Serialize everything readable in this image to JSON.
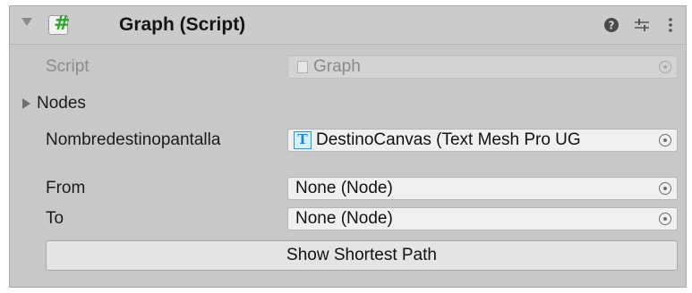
{
  "component": {
    "title": "Graph (Script)",
    "icons": {
      "script": "csharp-script-icon",
      "help": "help-icon",
      "presets": "presets-sliders-icon",
      "menu": "kebab-menu-icon"
    }
  },
  "fields": {
    "script": {
      "label": "Script",
      "value": "Graph"
    },
    "nodes": {
      "label": "Nodes"
    },
    "nombre": {
      "label": "Nombredestinopantalla",
      "value": "DestinoCanvas (Text Mesh Pro UG"
    },
    "from": {
      "label": "From",
      "value": "None (Node)"
    },
    "to": {
      "label": "To",
      "value": "None (Node)"
    }
  },
  "button": {
    "label": "Show Shortest Path"
  },
  "colors": {
    "panel": "#c8c8c8",
    "field": "#f0f0f0",
    "script_icon": "#2fa82a",
    "tmp_icon": "#1a9bd7"
  }
}
